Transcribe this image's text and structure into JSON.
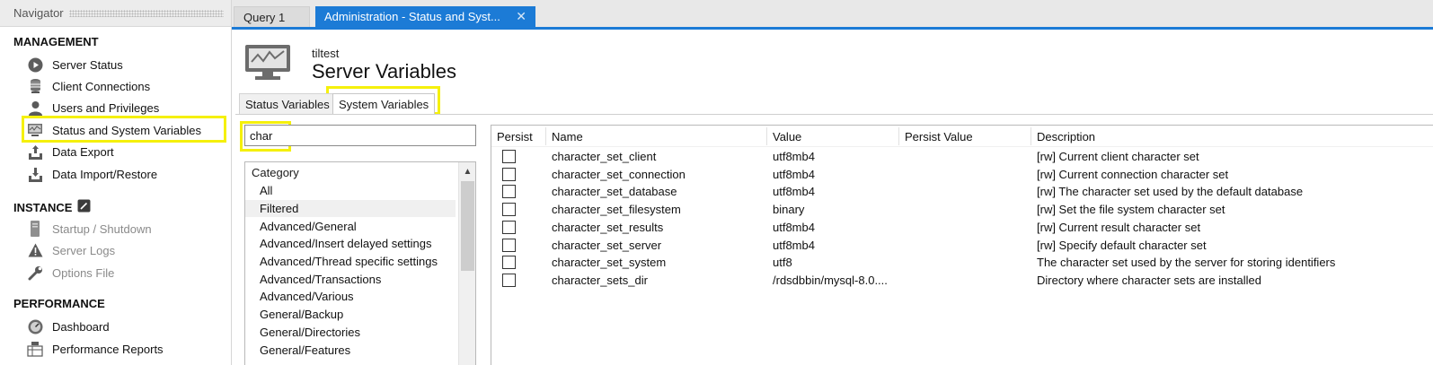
{
  "navigator": {
    "title": "Navigator",
    "management": {
      "label": "MANAGEMENT",
      "items": [
        {
          "label": "Server Status",
          "icon": "play-circle-icon"
        },
        {
          "label": "Client Connections",
          "icon": "database-connections-icon"
        },
        {
          "label": "Users and Privileges",
          "icon": "user-icon"
        },
        {
          "label": "Status and System Variables",
          "icon": "monitor-icon"
        },
        {
          "label": "Data Export",
          "icon": "export-icon"
        },
        {
          "label": "Data Import/Restore",
          "icon": "import-icon"
        }
      ]
    },
    "instance": {
      "label": "INSTANCE",
      "items": [
        {
          "label": "Startup / Shutdown",
          "icon": "server-icon"
        },
        {
          "label": "Server Logs",
          "icon": "warning-icon"
        },
        {
          "label": "Options File",
          "icon": "wrench-icon"
        }
      ]
    },
    "performance": {
      "label": "PERFORMANCE",
      "items": [
        {
          "label": "Dashboard",
          "icon": "dashboard-icon"
        },
        {
          "label": "Performance Reports",
          "icon": "reports-icon"
        }
      ]
    }
  },
  "tabs": [
    {
      "label": "Query 1",
      "active": false
    },
    {
      "label": "Administration - Status and Syst...",
      "active": true
    }
  ],
  "page": {
    "host": "tiltest",
    "title": "Server Variables"
  },
  "subtabs": [
    {
      "label": "Status Variables",
      "active": false
    },
    {
      "label": "System Variables",
      "active": true
    }
  ],
  "filter": {
    "value": "char"
  },
  "categories": {
    "header": "Category",
    "items": [
      "All",
      "Filtered",
      "Advanced/General",
      "Advanced/Insert delayed settings",
      "Advanced/Thread specific settings",
      "Advanced/Transactions",
      "Advanced/Various",
      "General/Backup",
      "General/Directories",
      "General/Features"
    ],
    "selected": "Filtered"
  },
  "table": {
    "columns": [
      "Persist",
      "Name",
      "Value",
      "Persist Value",
      "Description"
    ],
    "rows": [
      {
        "name": "character_set_client",
        "value": "utf8mb4",
        "persist_value": "",
        "description": "[rw] Current client character set"
      },
      {
        "name": "character_set_connection",
        "value": "utf8mb4",
        "persist_value": "",
        "description": "[rw] Current connection character set"
      },
      {
        "name": "character_set_database",
        "value": "utf8mb4",
        "persist_value": "",
        "description": "[rw] The character set used by the default database"
      },
      {
        "name": "character_set_filesystem",
        "value": "binary",
        "persist_value": "",
        "description": "[rw] Set the file system character set"
      },
      {
        "name": "character_set_results",
        "value": "utf8mb4",
        "persist_value": "",
        "description": "[rw] Current result character set"
      },
      {
        "name": "character_set_server",
        "value": "utf8mb4",
        "persist_value": "",
        "description": "[rw] Specify default character set"
      },
      {
        "name": "character_set_system",
        "value": "utf8",
        "persist_value": "",
        "description": "The character set used by the server for storing identifiers"
      },
      {
        "name": "character_sets_dir",
        "value": "/rdsdbbin/mysql-8.0....",
        "persist_value": "",
        "description": "Directory where character sets are installed"
      }
    ]
  },
  "colors": {
    "accent": "#1c7bd6",
    "highlight": "#f5f00c"
  }
}
